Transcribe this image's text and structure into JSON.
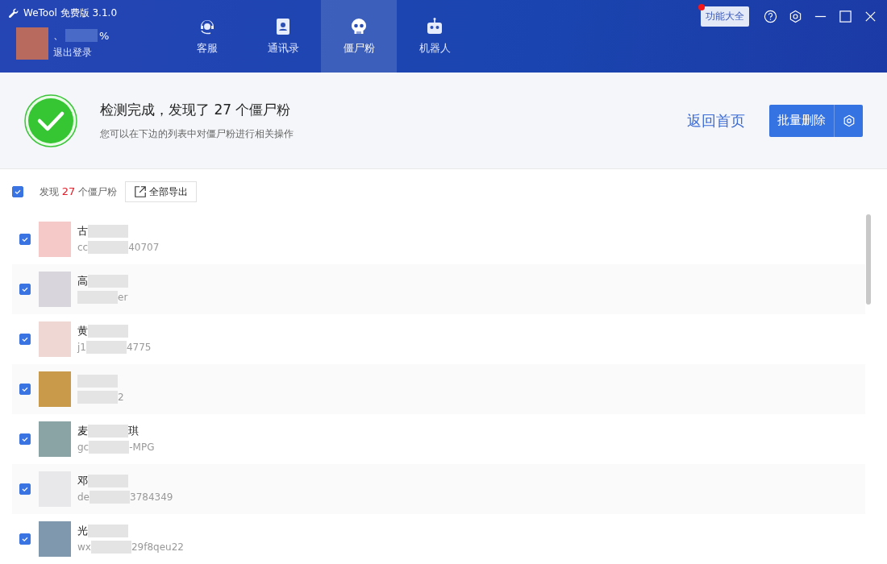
{
  "app": {
    "title": "WeTool 免费版 3.1.0",
    "user_name_parts": [
      "、",
      "%"
    ],
    "logout": "退出登录",
    "features_button": "功能大全",
    "features_badge": true
  },
  "nav_tabs": [
    {
      "label": "客服",
      "selected": false
    },
    {
      "label": "通讯录",
      "selected": false
    },
    {
      "label": "僵尸粉",
      "selected": true
    },
    {
      "label": "机器人",
      "selected": false
    }
  ],
  "result": {
    "title": "检测完成，发现了 27 个僵尸粉",
    "subtitle": "您可以在下边的列表中对僵尸粉进行相关操作",
    "back_link": "返回首页",
    "delete_button": "批量删除"
  },
  "toolbar": {
    "select_all_checked": true,
    "found_prefix": "发现",
    "count": "27",
    "found_suffix": "个僵尸粉",
    "export_button": "全部导出"
  },
  "contacts": [
    {
      "checked": true,
      "name_start": "古",
      "id_start": "cc",
      "id_end": "40707"
    },
    {
      "checked": true,
      "name_start": "高",
      "id_end": "er"
    },
    {
      "checked": true,
      "name_start": "黄",
      "id_start": "j1",
      "id_end": "4775"
    },
    {
      "checked": true,
      "id_end": "2"
    },
    {
      "checked": true,
      "name_start": "麦",
      "name_end": "琪",
      "id_start": "gc",
      "id_end": "-MPG"
    },
    {
      "checked": true,
      "name_start": "邓",
      "id_start": "de",
      "id_end": "3784349"
    },
    {
      "checked": true,
      "name_start": "光",
      "id_start": "wx",
      "id_end": "29f8qeu22"
    }
  ]
}
